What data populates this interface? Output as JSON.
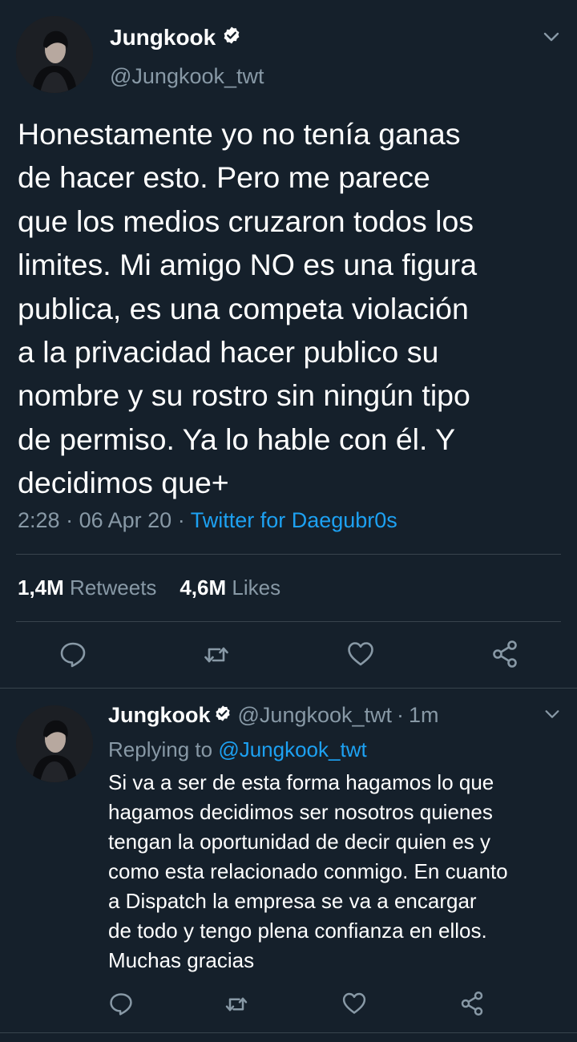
{
  "main_tweet": {
    "display_name": "Jungkook",
    "handle": "@Jungkook_twt",
    "text": "Honestamente yo no tenía ganas\nde hacer esto. Pero me parece\nque los medios cruzaron todos los\nlimites. Mi amigo NO es una figura\npublica, es una competa violación\na la privacidad hacer publico su\nnombre y su rostro sin ningún tipo\nde permiso. Ya lo hable con él. Y\ndecidimos que+",
    "time": "2:28",
    "date": "06 Apr 20",
    "source": "Twitter for Daegubr0s",
    "retweets_count": "1,4M",
    "retweets_label": "Retweets",
    "likes_count": "4,6M",
    "likes_label": "Likes",
    "icons": [
      "verified-badge-icon",
      "chevron-down-icon",
      "reply-icon",
      "retweet-icon",
      "like-icon",
      "share-icon"
    ]
  },
  "reply_tweet": {
    "display_name": "Jungkook",
    "handle": "@Jungkook_twt",
    "time_ago": "1m",
    "replying_prefix": "Replying to",
    "replying_to": "@Jungkook_twt",
    "text": "Si va a ser de esta forma hagamos lo que\nhagamos decidimos ser nosotros quienes\ntengan la oportunidad de decir quien es y\ncomo esta relacionado conmigo. En cuanto\na Dispatch la empresa se va a encargar\nde todo y tengo plena confianza en ellos.\nMuchas gracias",
    "icons": [
      "verified-badge-icon",
      "chevron-down-icon",
      "reply-icon",
      "retweet-icon",
      "like-icon",
      "share-icon"
    ]
  },
  "colors": {
    "background": "#15202b",
    "primary_text": "#ffffff",
    "secondary_text": "#8899a6",
    "link": "#1da1f2",
    "divider": "#38444d"
  }
}
